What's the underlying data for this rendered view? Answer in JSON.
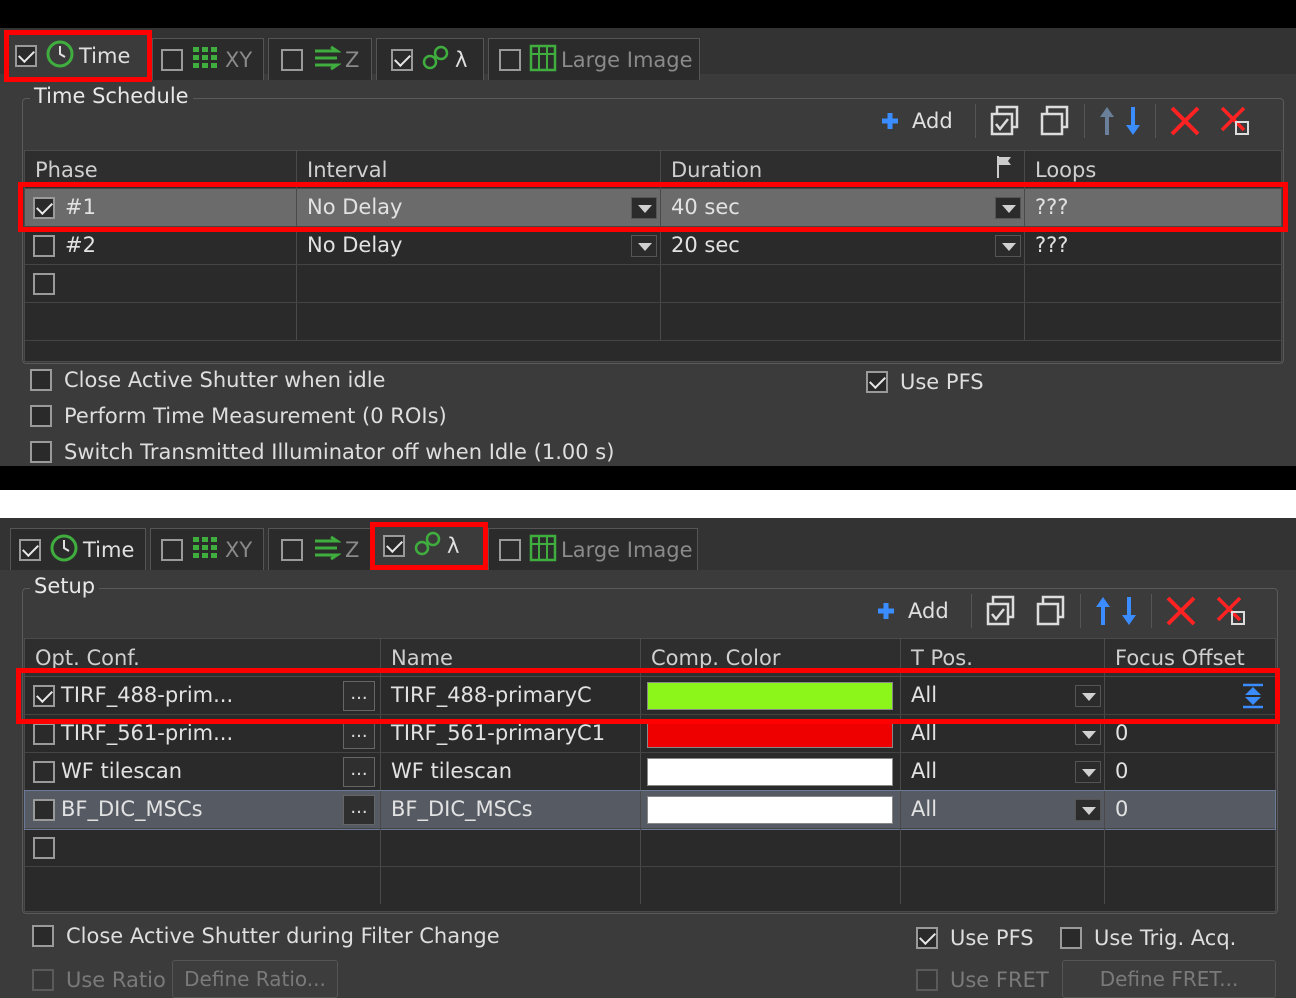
{
  "panel1": {
    "tabs": [
      {
        "label": "Time",
        "checked": true
      },
      {
        "label": "XY",
        "checked": false
      },
      {
        "label": "Z",
        "checked": false
      },
      {
        "label": "λ",
        "checked": true
      },
      {
        "label": "Large Image",
        "checked": false
      }
    ],
    "group_title": "Time Schedule",
    "toolbar": {
      "add_label": "Add"
    },
    "columns": [
      "Phase",
      "Interval",
      "Duration",
      "Loops"
    ],
    "rows": [
      {
        "checked": true,
        "phase": "#1",
        "interval": "No Delay",
        "duration": "40 sec",
        "loops": "???"
      },
      {
        "checked": false,
        "phase": "#2",
        "interval": "No Delay",
        "duration": "20 sec",
        "loops": "???"
      }
    ],
    "options": {
      "close_shutter": "Close Active Shutter when idle",
      "time_measurement": "Perform Time Measurement (0 ROIs)",
      "switch_illuminator": "Switch Transmitted Illuminator off when Idle (1.00 s)",
      "use_pfs": "Use PFS"
    }
  },
  "panel2": {
    "tabs": [
      {
        "label": "Time",
        "checked": true
      },
      {
        "label": "XY",
        "checked": false
      },
      {
        "label": "Z",
        "checked": false
      },
      {
        "label": "λ",
        "checked": true
      },
      {
        "label": "Large Image",
        "checked": false
      }
    ],
    "group_title": "Setup",
    "toolbar": {
      "add_label": "Add"
    },
    "columns": [
      "Opt. Conf.",
      "Name",
      "Comp. Color",
      "T Pos.",
      "Focus Offset"
    ],
    "rows": [
      {
        "checked": true,
        "opt_conf": "TIRF_488-prim...",
        "ellipsis": "...",
        "name": "TIRF_488-primaryC",
        "color": "#8cf51a",
        "tpos": "All",
        "focus": ""
      },
      {
        "checked": false,
        "opt_conf": "TIRF_561-prim...",
        "ellipsis": "...",
        "name": "TIRF_561-primaryC1",
        "color": "#ee0000",
        "tpos": "All",
        "focus": "0"
      },
      {
        "checked": false,
        "opt_conf": "WF tilescan",
        "ellipsis": "...",
        "name": "WF tilescan",
        "color": "#ffffff",
        "tpos": "All",
        "focus": "0"
      },
      {
        "checked": false,
        "opt_conf": "BF_DIC_MSCs",
        "ellipsis": "...",
        "name": "BF_DIC_MSCs",
        "color": "#ffffff",
        "tpos": "All",
        "focus": "0"
      }
    ],
    "options": {
      "close_shutter_filter": "Close Active Shutter during Filter Change",
      "use_pfs": "Use PFS",
      "use_trig_acq": "Use Trig. Acq.",
      "use_ratio": "Use Ratio",
      "define_ratio": "Define Ratio...",
      "use_fret": "Use FRET",
      "define_fret": "Define FRET..."
    }
  },
  "colors": {
    "highlight": "#ff0000",
    "accent_blue": "#3a8cff",
    "icon_green": "#3fae3f"
  }
}
